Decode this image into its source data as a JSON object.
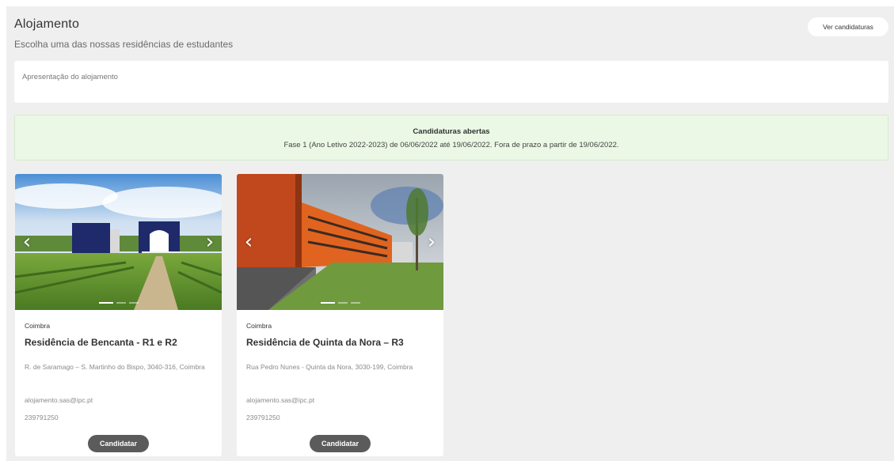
{
  "header": {
    "title": "Alojamento",
    "subtitle": "Escolha uma das nossas residências de estudantes",
    "view_applications_label": "Ver candidaturas"
  },
  "intro": {
    "text": "Apresentação do alojamento"
  },
  "notice": {
    "title": "Candidaturas abertas",
    "text": "Fase 1 (Ano Letivo 2022-2023) de 06/06/2022 até 19/06/2022. Fora de prazo a partir de 19/06/2022."
  },
  "residences": [
    {
      "city": "Coimbra",
      "name": "Residência de Bencanta - R1 e R2",
      "address": "R. de Saramago – S. Martinho do Bispo, 3040-316, Coimbra",
      "email": "alojamento.sas@ipc.pt",
      "phone": "239791250",
      "apply_label": "Candidatar",
      "prev_icon": "‹",
      "next_icon": "›"
    },
    {
      "city": "Coimbra",
      "name": "Residência de Quinta da Nora – R3",
      "address": "Rua Pedro Nunes - Quinta da Nora, 3030-199, Coimbra",
      "email": "alojamento.sas@ipc.pt",
      "phone": "239791250",
      "apply_label": "Candidatar",
      "prev_icon": "‹",
      "next_icon": "›"
    }
  ],
  "colors": {
    "page_background": "#efefef",
    "notice_background": "#eaf8e5",
    "apply_button": "#5b5b5b"
  }
}
